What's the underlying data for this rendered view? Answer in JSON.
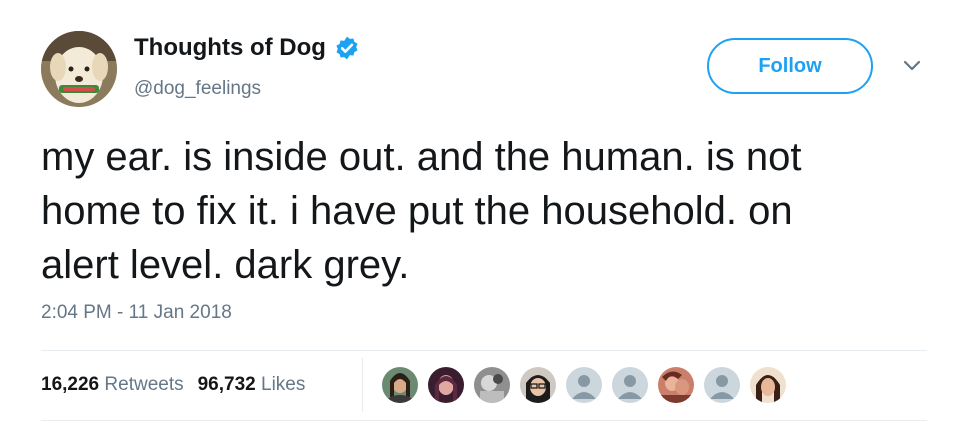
{
  "user": {
    "display_name": "Thoughts of Dog",
    "handle": "@dog_feelings",
    "verified": true,
    "avatar_icon": "dog-avatar"
  },
  "follow_label": "Follow",
  "tweet": {
    "text": "my ear. is inside out. and the human. is not\nhome to fix it. i have put the household. on\nalert level. dark grey.",
    "timestamp": "2:04 PM - 11 Jan 2018"
  },
  "stats": {
    "retweets_count": "16,226",
    "retweets_label": "Retweets",
    "likes_count": "96,732",
    "likes_label": "Likes"
  },
  "colors": {
    "accent": "#1da1f2",
    "secondary_text": "#657786",
    "primary_text": "#14171a",
    "divider": "#e6ecf0"
  },
  "liker_avatars": [
    "photo",
    "photo",
    "photo",
    "photo",
    "default-egg",
    "default-egg",
    "photo",
    "default-egg",
    "photo"
  ]
}
